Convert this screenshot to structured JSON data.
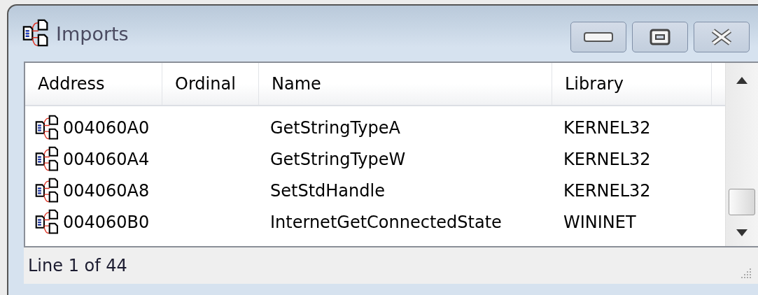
{
  "window": {
    "title": "Imports"
  },
  "table": {
    "columns": [
      "Address",
      "Ordinal",
      "Name",
      "Library"
    ],
    "rows": [
      {
        "address": "004060A0",
        "name": "GetStringTypeA",
        "library": "KERNEL32"
      },
      {
        "address": "004060A4",
        "name": "GetStringTypeW",
        "library": "KERNEL32"
      },
      {
        "address": "004060A8",
        "name": "SetStdHandle",
        "library": "KERNEL32"
      },
      {
        "address": "004060B0",
        "name": "InternetGetConnectedState",
        "library": "WININET"
      }
    ]
  },
  "status_bar": {
    "text": "Line 1 of 44"
  }
}
